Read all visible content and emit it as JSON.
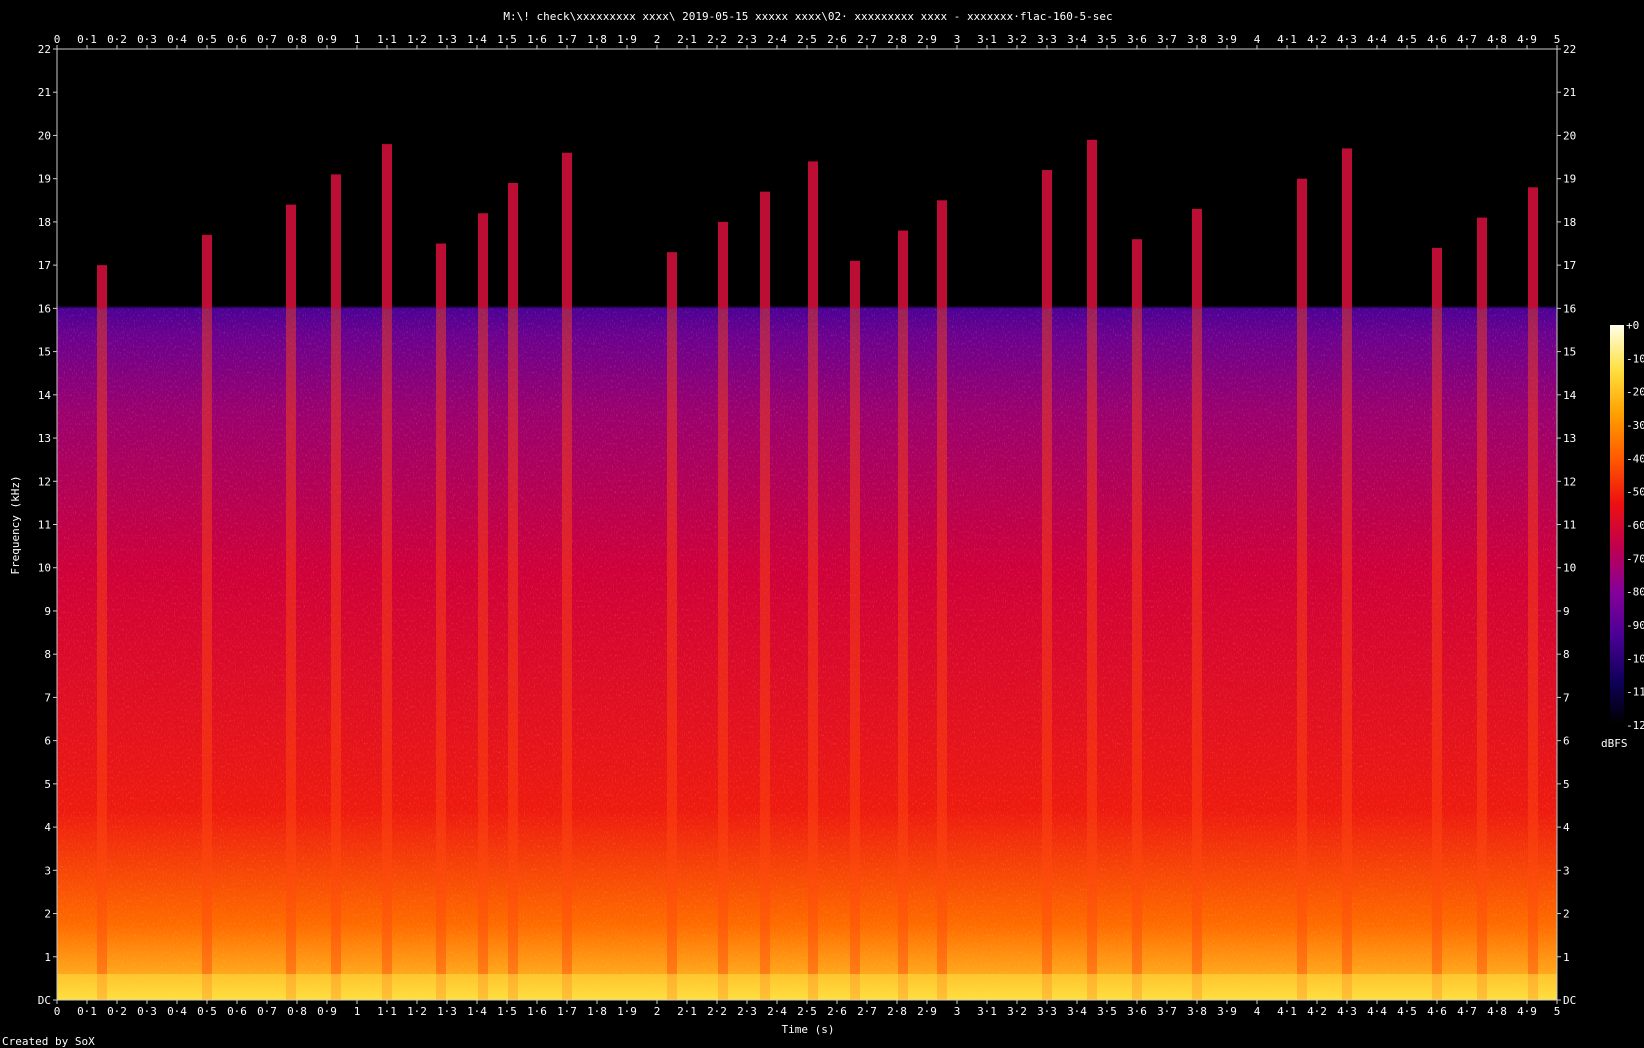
{
  "chart_data": {
    "type": "heatmap",
    "title": "M:\\! check\\xxxxxxxxx xxxx\\ 2019-05-15  xxxxx xxxx\\02· xxxxxxxxx xxxx - xxxxxxx·flac-160-5-sec",
    "xlabel": "Time (s)",
    "ylabel": "Frequency (kHz)",
    "xlim": [
      0,
      5
    ],
    "ylim": [
      0,
      22
    ],
    "x_ticks": [
      "0",
      "0·1",
      "0·2",
      "0·3",
      "0·4",
      "0·5",
      "0·6",
      "0·7",
      "0·8",
      "0·9",
      "1",
      "1·1",
      "1·2",
      "1·3",
      "1·4",
      "1·5",
      "1·6",
      "1·7",
      "1·8",
      "1·9",
      "2",
      "2·1",
      "2·2",
      "2·3",
      "2·4",
      "2·5",
      "2·6",
      "2·7",
      "2·8",
      "2·9",
      "3",
      "3·1",
      "3·2",
      "3·3",
      "3·4",
      "3·5",
      "3·6",
      "3·7",
      "3·8",
      "3·9",
      "4",
      "4·1",
      "4·2",
      "4·3",
      "4·4",
      "4·5",
      "4·6",
      "4·7",
      "4·8",
      "4·9",
      "5"
    ],
    "y_ticks": [
      "DC",
      "1",
      "2",
      "3",
      "4",
      "5",
      "6",
      "7",
      "8",
      "9",
      "10",
      "11",
      "12",
      "13",
      "14",
      "15",
      "16",
      "17",
      "18",
      "19",
      "20",
      "21",
      "22"
    ],
    "colorbar": {
      "unit": "dBFS",
      "range": [
        -120,
        0
      ],
      "ticks": [
        "+0",
        "-10",
        "-20",
        "-30",
        "-40",
        "-50",
        "-60",
        "-70",
        "-80",
        "-90",
        "-100",
        "-110",
        "-120"
      ],
      "colors": [
        "#000000",
        "#10005a",
        "#4a0096",
        "#86009a",
        "#c0004e",
        "#ee1010",
        "#ff5a00",
        "#ffa000",
        "#ffe040",
        "#ffffe8"
      ]
    },
    "lowpass_cutoff_khz": 16,
    "transients_s": [
      0.15,
      0.5,
      0.78,
      0.93,
      1.1,
      1.28,
      1.42,
      1.52,
      1.7,
      2.05,
      2.22,
      2.36,
      2.52,
      2.66,
      2.82,
      2.95,
      3.3,
      3.45,
      3.6,
      3.8,
      4.15,
      4.3,
      4.6,
      4.75,
      4.92
    ]
  },
  "footer": {
    "credit": "Created by SoX"
  }
}
